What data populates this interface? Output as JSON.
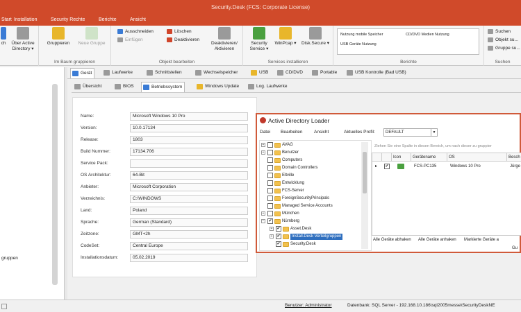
{
  "app": {
    "title": "Security.Desk (FCS: Corporate License)"
  },
  "menu": [
    "Start",
    "Installation",
    "Security Rechte",
    "Berichte",
    "Ansicht"
  ],
  "ribbon": {
    "start_group": {
      "left_stub": "ch",
      "active_directory": "Über Active Directory ▾"
    },
    "baum_group": {
      "label": "Im Baum gruppieren",
      "gruppieren": "Gruppieren",
      "neue_gruppe": "Neue Gruppe"
    },
    "objekt_group": {
      "label": "Objekt bearbeiten",
      "ausschneiden": "Ausschneiden",
      "einfuegen": "Einfügen",
      "loeschen": "Löschen",
      "deaktivieren": "Deaktivieren",
      "deaktivieren_aktivieren": "Deaktivieren/ Aktivieren"
    },
    "services_group": {
      "label": "Services installieren",
      "security_service": "Security Service ▾",
      "winpcap": "WinPcap ▾",
      "disk_secure": "Disk.Secure ▾"
    },
    "berichte_group": {
      "label": "Berichte",
      "items": [
        "Nutzung mobile Speicher",
        "CD/DVD Medien Nutzung",
        "USB Geräte Nutzung"
      ]
    },
    "suchen_group": {
      "label": "Suchen",
      "suchen": "Suchen",
      "objekt_suchen": "Objekt su...",
      "gruppe_suchen": "Gruppe su..."
    }
  },
  "left_panel": {
    "item": "gruppen"
  },
  "tabs_top": [
    "Gerät",
    "Laufwerke",
    "Schnittstellen",
    "Wechselspeicher",
    "USB",
    "CD/DVD",
    "Portable",
    "USB Kontrolle (Bad USB)"
  ],
  "tabs_second": [
    "Übersicht",
    "BIOS",
    "Betriebssystem",
    "Windows Update",
    "Log. Laufwerke"
  ],
  "active_tab_second": "Betriebssystem",
  "os_info": [
    {
      "label": "Name:",
      "value": "Microsoft Windows 10 Pro"
    },
    {
      "label": "Version:",
      "value": "10.0.17134"
    },
    {
      "label": "Release:",
      "value": "1803"
    },
    {
      "label": "Build Nummer:",
      "value": "17134.706"
    },
    {
      "label": "Service Pack:",
      "value": ""
    },
    {
      "label": "OS Architektur:",
      "value": "64-Bit"
    },
    {
      "label": "Anbieter:",
      "value": "Microsoft Corporation"
    },
    {
      "label": "Verzeichnis:",
      "value": "C:\\WINDOWS"
    },
    {
      "label": "Land:",
      "value": "Poland"
    },
    {
      "label": "Sprache:",
      "value": "German (Standard)"
    },
    {
      "label": "Zeitzone:",
      "value": "GMT+2h"
    },
    {
      "label": "CodeSet:",
      "value": "Central Europe"
    },
    {
      "label": "Installationsdatum:",
      "value": "05.02.2019"
    }
  ],
  "dialog": {
    "title": "Active Directory Loader",
    "menu": [
      "Datei",
      "Bearbeiten",
      "Ansicht"
    ],
    "profile_label": "Aktuelles Profil:",
    "profile_value": "DEFAULT",
    "grid_hint": "Ziehen Sie eine Spalte in diesen Bereich, um nach dieser zu gruppier",
    "grid_headers": [
      "Icon",
      "Gerätename",
      "OS",
      "Besch"
    ],
    "grid_row": {
      "name": "FCS-PC135",
      "os": "Windows 10 Pro",
      "desc": "Jürge"
    },
    "tree": [
      {
        "label": "AVAG",
        "expander": "+",
        "checked": "",
        "indent": 0
      },
      {
        "label": "Benutzer",
        "expander": "+",
        "checked": "",
        "indent": 0
      },
      {
        "label": "Computers",
        "expander": "",
        "checked": "",
        "indent": 0
      },
      {
        "label": "Domain Controllers",
        "expander": "",
        "checked": "",
        "indent": 0
      },
      {
        "label": "Eltville",
        "expander": "",
        "checked": "",
        "indent": 0
      },
      {
        "label": "Entwicklung",
        "expander": "",
        "checked": "",
        "indent": 0
      },
      {
        "label": "FCS-Server",
        "expander": "",
        "checked": "",
        "indent": 0
      },
      {
        "label": "ForeignSecurityPrincipals",
        "expander": "",
        "checked": "",
        "indent": 0
      },
      {
        "label": "Managed Service Accounts",
        "expander": "",
        "checked": "",
        "indent": 0
      },
      {
        "label": "München",
        "expander": "+",
        "checked": "",
        "indent": 0
      },
      {
        "label": "Nürnberg",
        "expander": "−",
        "checked": "✔",
        "indent": 0
      },
      {
        "label": "Asset.Desk",
        "expander": "+",
        "checked": "✔",
        "indent": 1
      },
      {
        "label": "Install.Desk Verteilgruppen",
        "expander": "+",
        "checked": "✔",
        "indent": 1,
        "selected": true
      },
      {
        "label": "Security.Desk",
        "expander": "",
        "checked": "✔",
        "indent": 1
      }
    ],
    "buttons": [
      "Alle Geräte abhaken",
      "Alle Geräte anhaken",
      "Markierte Geräte a"
    ],
    "footer_stub": "Gu"
  },
  "status": {
    "user": "Benutzer: Administrator",
    "db": "Datenbank: SQL Server - 192.168.10.186\\sql2005messe\\SecurityDeskNE"
  },
  "colors": {
    "accent": "#d04a2a",
    "selection": "#2f6fbf"
  }
}
